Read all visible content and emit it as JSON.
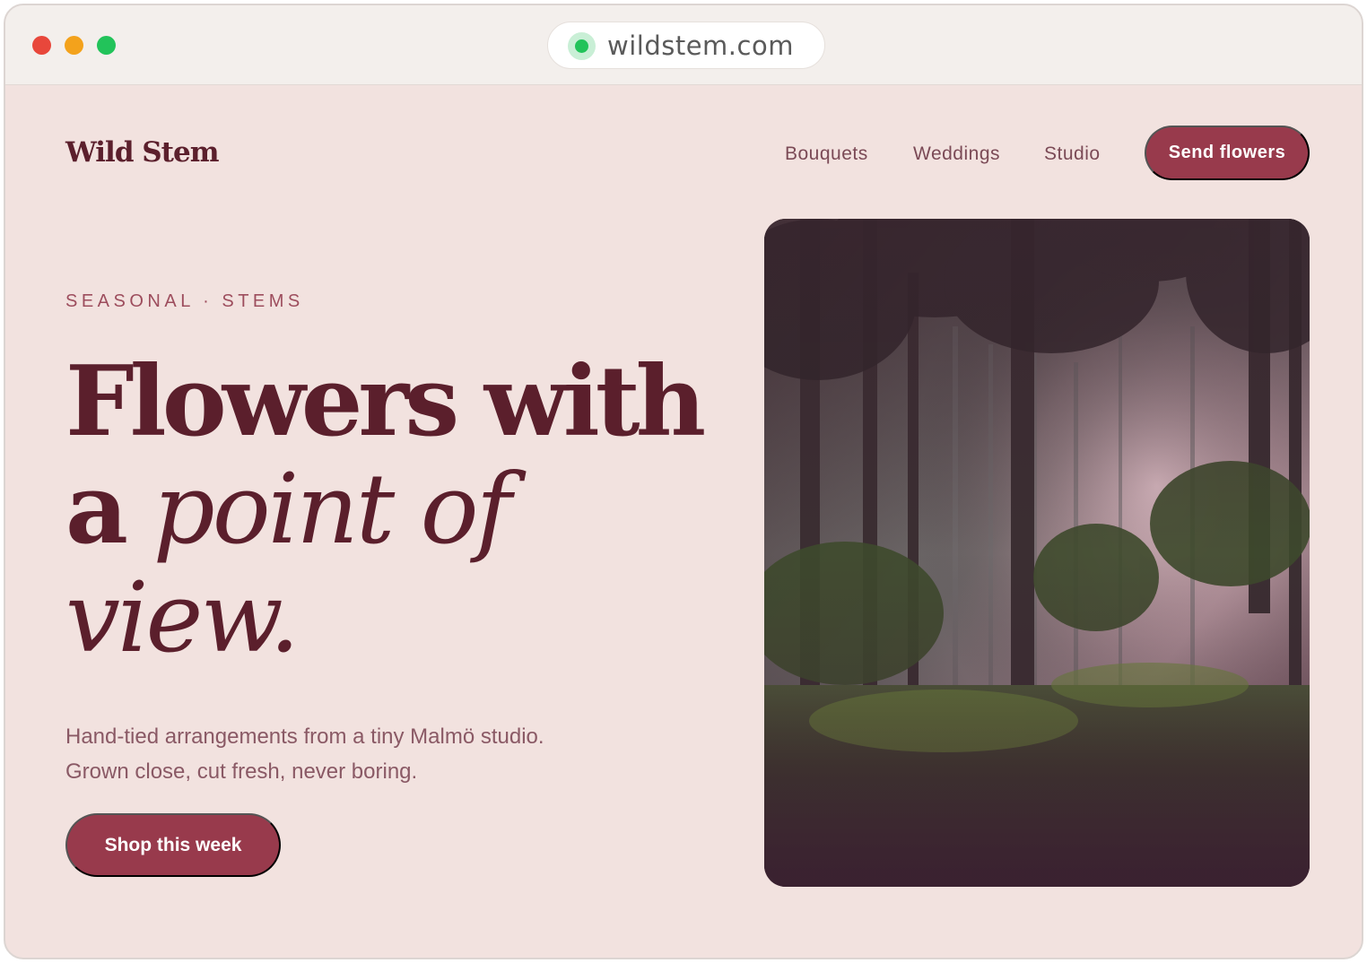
{
  "browser": {
    "url": "wildstem.com"
  },
  "header": {
    "logo": "Wild Stem",
    "nav": [
      "Bouquets",
      "Weddings",
      "Studio"
    ],
    "cta": "Send flowers"
  },
  "hero": {
    "eyebrow": "SEASONAL · STEMS",
    "headline_line1": "Flowers with",
    "headline_a": "a",
    "headline_italic1": "point of",
    "headline_italic2": "view.",
    "subtitle_line1": "Hand-tied arrangements from a tiny Malmö studio.",
    "subtitle_line2": "Grown close, cut fresh, never boring.",
    "cta": "Shop this week",
    "image": "misty-forest-photo"
  },
  "colors": {
    "background": "#f2e2df",
    "accent": "#983a4c",
    "headline": "#5b1f2c"
  }
}
